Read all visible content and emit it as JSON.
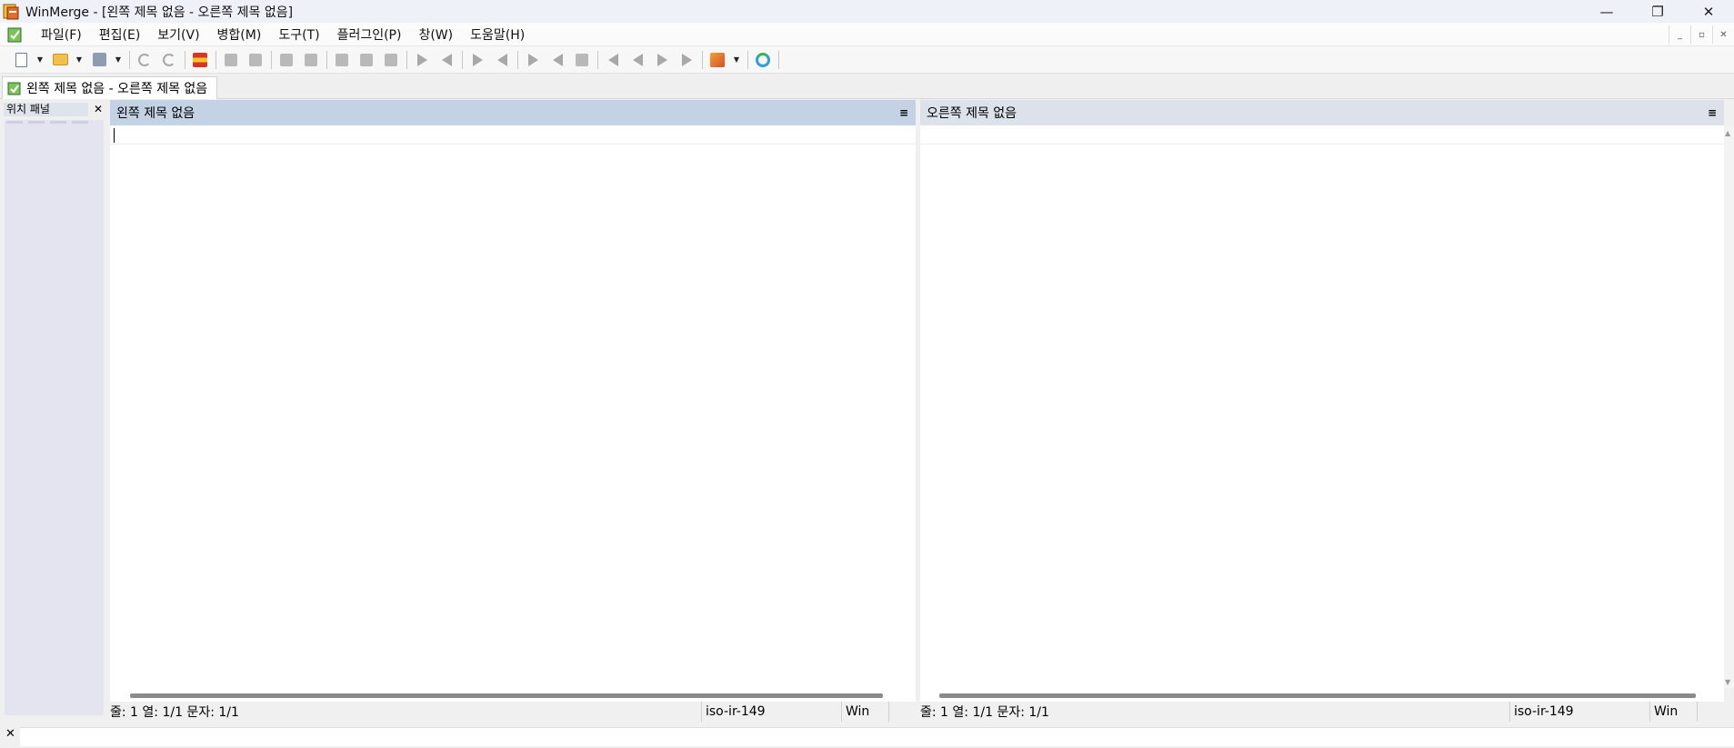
{
  "window": {
    "title": "WinMerge - [왼쪽 제목 없음 - 오른쪽 제목 없음]",
    "controls": {
      "minimize": "—",
      "restore": "❐",
      "close": "✕"
    }
  },
  "menu": {
    "items": [
      "파일(F)",
      "편집(E)",
      "보기(V)",
      "병합(M)",
      "도구(T)",
      "플러그인(P)",
      "창(W)",
      "도움말(H)"
    ],
    "mdi_controls": [
      "_",
      "▫",
      "✕"
    ]
  },
  "toolbar": {
    "icons": [
      "new-document-icon",
      "open-folder-icon",
      "save-icon",
      "undo-icon",
      "redo-icon",
      "compare-icon",
      "next-diff-icon",
      "prev-diff-icon",
      "first-diff-icon",
      "last-diff-icon",
      "copy-right-icon",
      "copy-left-icon",
      "tools-icon",
      "refresh-icon"
    ]
  },
  "tab": {
    "label": "왼쪽 제목 없음 - 오른쪽 제목 없음"
  },
  "location_pane": {
    "title": "위치 패널",
    "close": "✕"
  },
  "left_pane": {
    "title": "왼쪽 제목 없음",
    "menu": "≡",
    "status": {
      "position": "줄: 1   열: 1/1   문자: 1/1",
      "encoding": "iso-ir-149",
      "eol": "Win"
    }
  },
  "right_pane": {
    "title": "오른쪽 제목 없음",
    "menu": "≡",
    "status": {
      "position": "줄: 1   열: 1/1   문자: 1/1",
      "encoding": "iso-ir-149",
      "eol": "Win"
    }
  },
  "bottom_bar": {
    "close": "✕"
  },
  "scroll": {
    "up": "▲",
    "down": "▼"
  }
}
